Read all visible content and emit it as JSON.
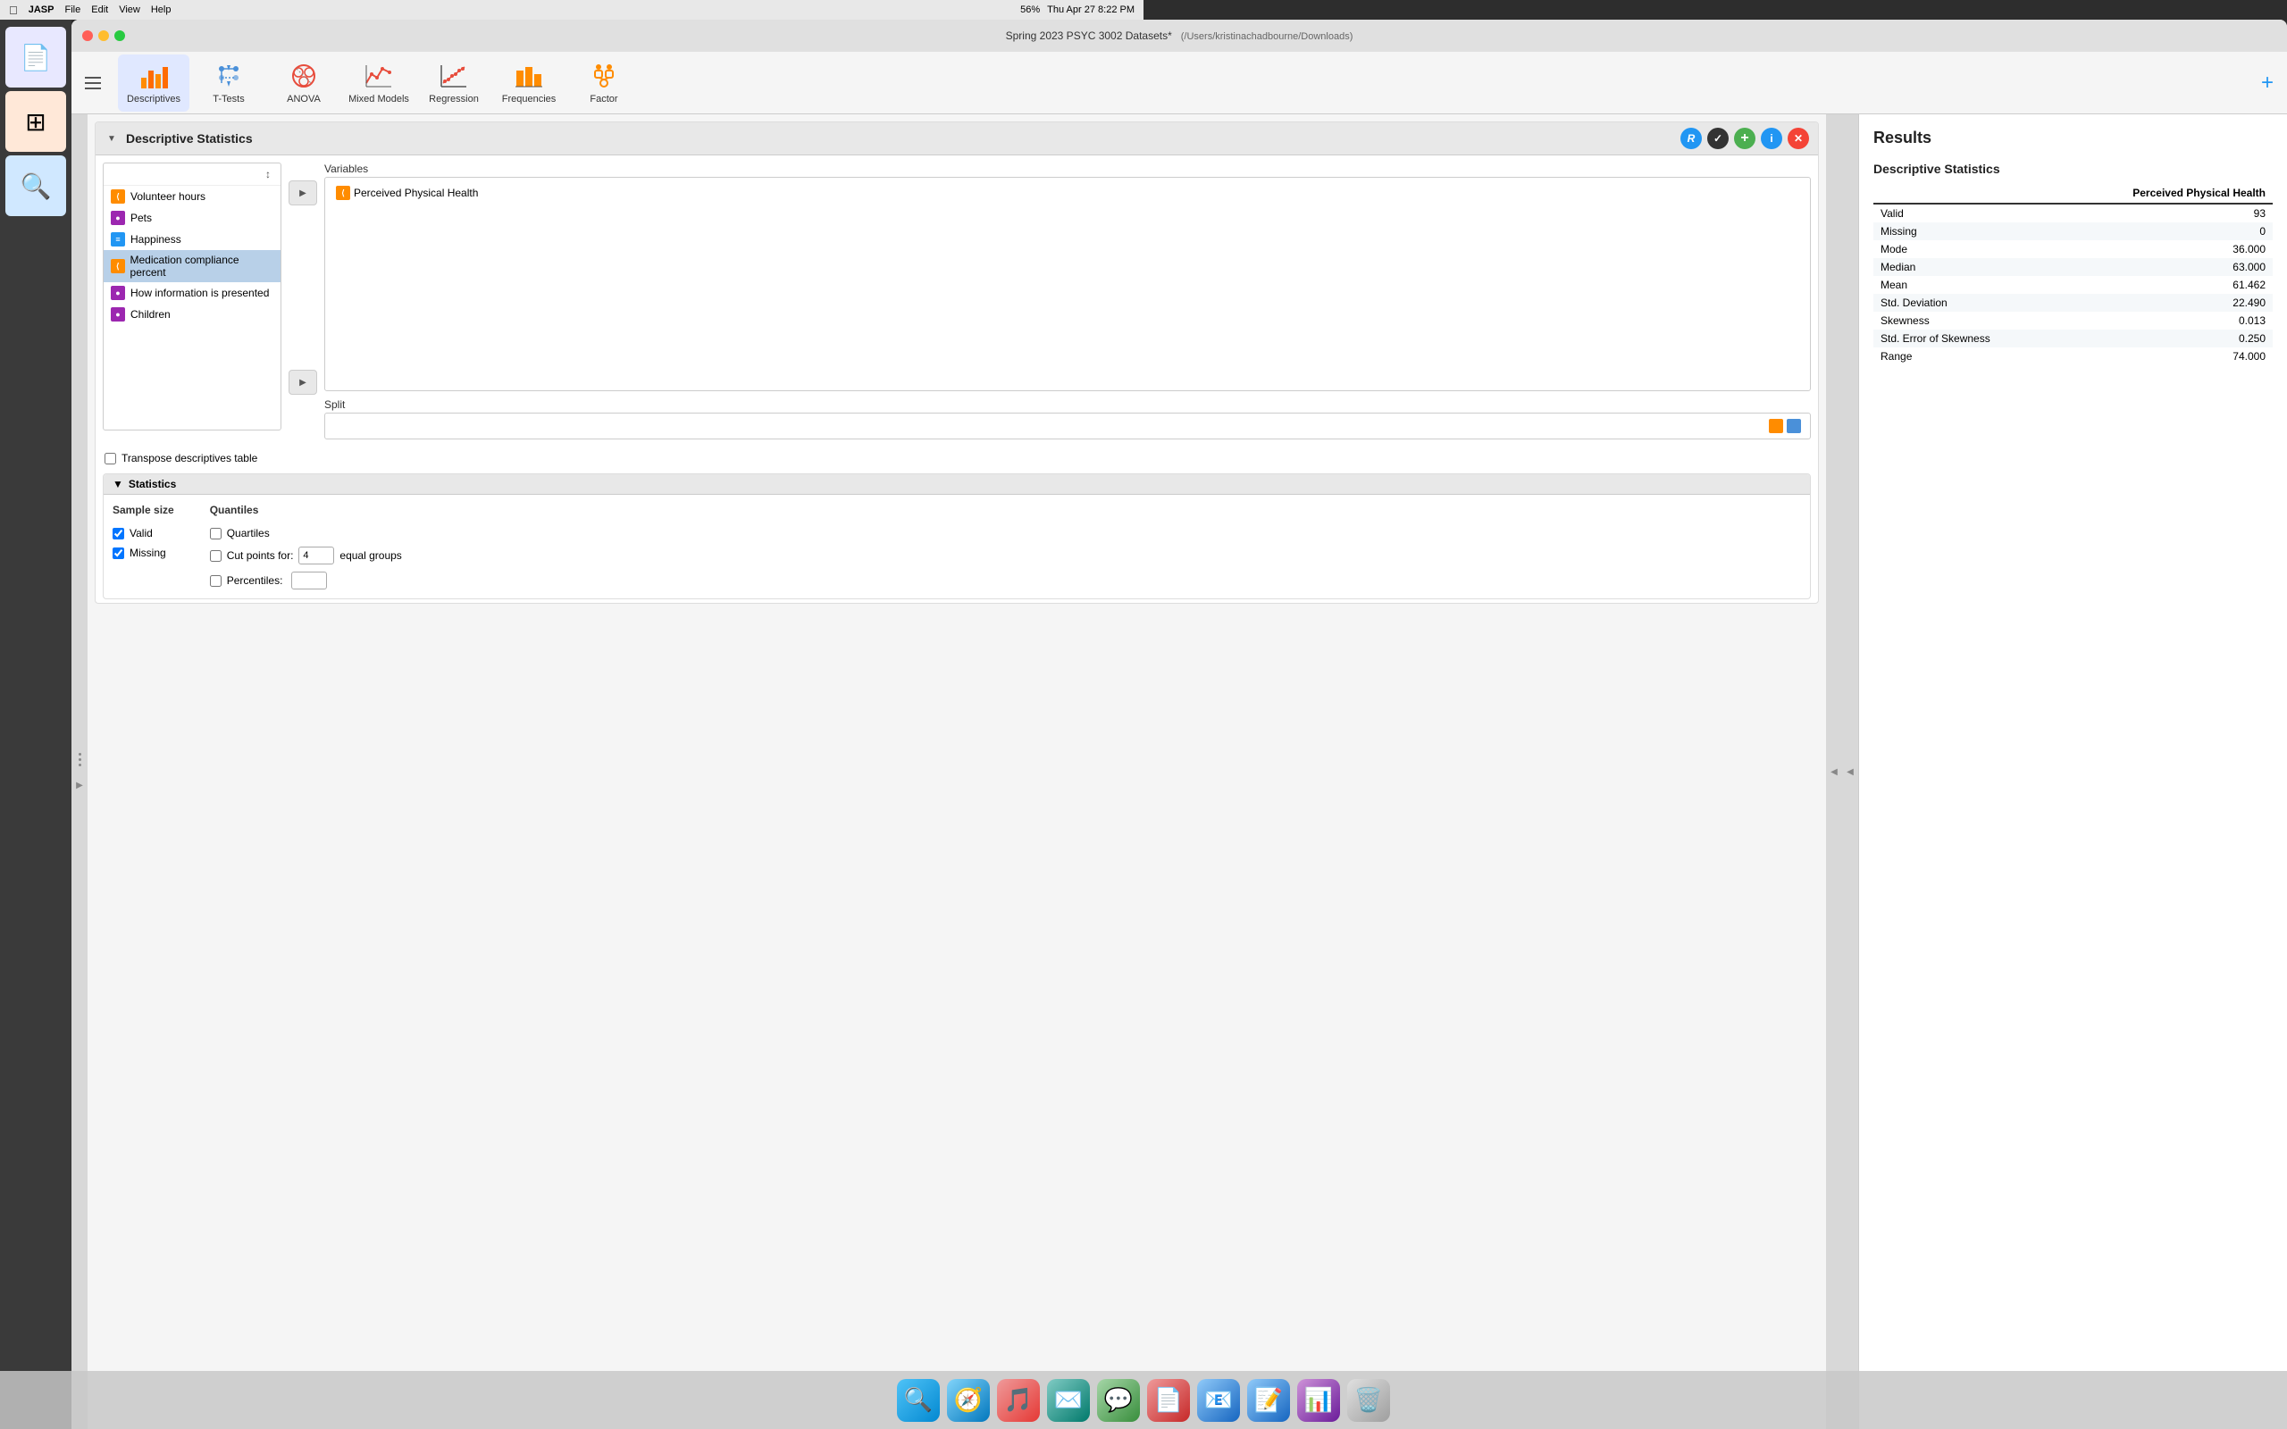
{
  "menubar": {
    "apple": "&#63743;",
    "app_name": "JASP",
    "time": "Thu Apr 27  8:22 PM",
    "battery": "56%"
  },
  "titlebar": {
    "title": "Spring 2023 PSYC 3002 Datasets*",
    "subtitle": "(/Users/kristinachadbourne/Downloads)"
  },
  "toolbar": {
    "menu_icon": "☰",
    "items": [
      {
        "id": "descriptives",
        "label": "Descriptives"
      },
      {
        "id": "ttests",
        "label": "T-Tests"
      },
      {
        "id": "anova",
        "label": "ANOVA"
      },
      {
        "id": "mixed_models",
        "label": "Mixed Models"
      },
      {
        "id": "regression",
        "label": "Regression"
      },
      {
        "id": "frequencies",
        "label": "Frequencies"
      },
      {
        "id": "factor",
        "label": "Factor"
      }
    ],
    "add_label": "+"
  },
  "analysis": {
    "title": "Descriptive Statistics",
    "actions": {
      "r": "R",
      "check": "✓",
      "add": "+",
      "info": "i",
      "close": "✕"
    },
    "variables": {
      "label": "Variables",
      "items": [
        {
          "name": "Volunteer hours",
          "type": "scale",
          "selected": false
        },
        {
          "name": "Pets",
          "type": "nominal",
          "selected": false
        },
        {
          "name": "Happiness",
          "type": "continuous",
          "selected": false
        },
        {
          "name": "Medication compliance percent",
          "type": "scale_orange",
          "selected": true
        },
        {
          "name": "How information is presented",
          "type": "nominal_purple",
          "selected": false
        },
        {
          "name": "Children",
          "type": "nominal_purple2",
          "selected": false
        }
      ]
    },
    "assigned_variables": {
      "label": "Variables",
      "items": [
        "Perceived Physical Health"
      ]
    },
    "split_label": "Split",
    "transpose_label": "Transpose descriptives table"
  },
  "statistics": {
    "section_label": "Statistics",
    "sample_size": {
      "label": "Sample size",
      "valid": {
        "label": "Valid",
        "checked": true
      },
      "missing": {
        "label": "Missing",
        "checked": true
      }
    },
    "quantiles": {
      "label": "Quantiles",
      "quartiles": {
        "label": "Quartiles",
        "checked": false
      },
      "cut_points": {
        "label": "Cut points for:",
        "checked": false,
        "value": "4",
        "suffix": "equal groups"
      },
      "percentiles": {
        "label": "Percentiles:",
        "checked": false
      }
    }
  },
  "results": {
    "title": "Results",
    "table_title": "Descriptive Statistics",
    "subtitle": "Descriptive Statistics",
    "column_header": "Perceived Physical Health",
    "rows": [
      {
        "label": "Valid",
        "value": "93"
      },
      {
        "label": "Missing",
        "value": "0"
      },
      {
        "label": "Mode",
        "value": "36.000"
      },
      {
        "label": "Median",
        "value": "63.000"
      },
      {
        "label": "Mean",
        "value": "61.462"
      },
      {
        "label": "Std. Deviation",
        "value": "22.490"
      },
      {
        "label": "Skewness",
        "value": "0.013"
      },
      {
        "label": "Std. Error of Skewness",
        "value": "0.250"
      },
      {
        "label": "Range",
        "value": "74.000"
      }
    ]
  },
  "dock": {
    "items": [
      {
        "id": "finder",
        "icon": "🔍",
        "label": "Finder"
      },
      {
        "id": "safari",
        "icon": "🧭",
        "label": "Safari"
      },
      {
        "id": "music",
        "icon": "🎵",
        "label": "Music"
      },
      {
        "id": "spark",
        "icon": "✉️",
        "label": "Spark"
      },
      {
        "id": "messages",
        "icon": "💬",
        "label": "Messages"
      },
      {
        "id": "acrobat",
        "icon": "📄",
        "label": "Acrobat"
      },
      {
        "id": "mail",
        "icon": "📧",
        "label": "Mail"
      },
      {
        "id": "word",
        "icon": "📝",
        "label": "Word"
      },
      {
        "id": "jasp",
        "icon": "📊",
        "label": "JASP"
      },
      {
        "id": "trash",
        "icon": "🗑️",
        "label": "Trash"
      }
    ]
  }
}
